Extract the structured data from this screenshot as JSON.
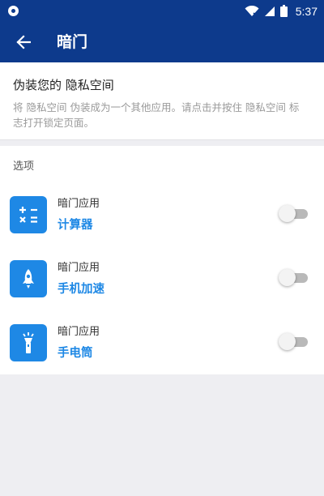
{
  "status_bar": {
    "time": "5:37",
    "icons": [
      "notification-dot-icon",
      "wifi-icon",
      "signal-icon",
      "battery-icon"
    ]
  },
  "app_bar": {
    "title": "暗门",
    "back_icon": "arrow-left-icon"
  },
  "intro": {
    "title": "伪装您的 隐私空间",
    "description": "将 隐私空间 伪装成为一个其他应用。请点击并按住 隐私空间 标志打开锁定页面。"
  },
  "options": {
    "header": "选项",
    "items": [
      {
        "label": "暗门应用",
        "name": "计算器",
        "icon": "calculator-icon",
        "enabled": false
      },
      {
        "label": "暗门应用",
        "name": "手机加速",
        "icon": "rocket-icon",
        "enabled": false
      },
      {
        "label": "暗门应用",
        "name": "手电筒",
        "icon": "flashlight-icon",
        "enabled": false
      }
    ]
  },
  "colors": {
    "primary": "#0d3a8c",
    "accent": "#1e88e5",
    "background": "#eeeef2"
  }
}
